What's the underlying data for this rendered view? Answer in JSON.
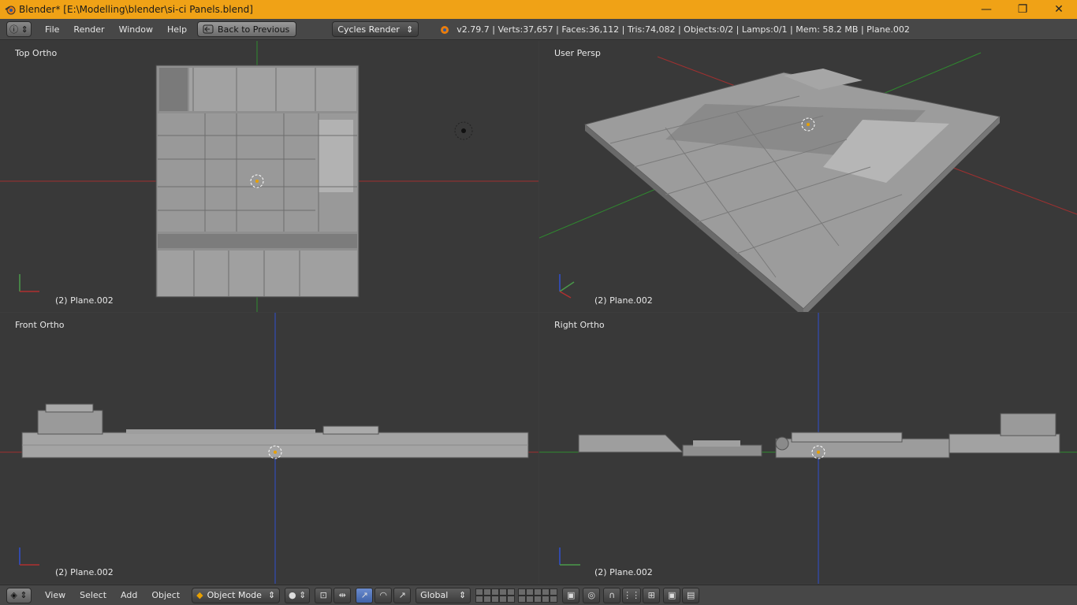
{
  "window": {
    "title": "Blender* [E:\\Modelling\\blender\\si-ci  Panels.blend]",
    "minimize": "—",
    "maximize": "❐",
    "close": "✕"
  },
  "header": {
    "menus": [
      "File",
      "Render",
      "Window",
      "Help"
    ],
    "back_label": "Back to Previous",
    "render_engine": "Cycles Render",
    "stats": "v2.79.7 | Verts:37,657 | Faces:36,112 | Tris:74,082 | Objects:0/2 | Lamps:0/1 | Mem: 58.2 MB | Plane.002"
  },
  "viewports": {
    "top": {
      "label": "Top Ortho",
      "object": "(2) Plane.002"
    },
    "persp": {
      "label": "User Persp",
      "object": "(2) Plane.002"
    },
    "front": {
      "label": "Front Ortho",
      "object": "(2) Plane.002"
    },
    "right": {
      "label": "Right Ortho",
      "object": "(2) Plane.002"
    }
  },
  "footer": {
    "menus": [
      "View",
      "Select",
      "Add",
      "Object"
    ],
    "mode": "Object Mode",
    "orientation": "Global"
  },
  "colors": {
    "titlebar": "#f0a216",
    "viewport_bg": "#393939",
    "header_bg": "#474747",
    "x_axis": "#b03030",
    "y_axis": "#3aa83a",
    "z_axis": "#3050d0",
    "mesh": "#9a9a9a"
  },
  "icons": [
    "blender-logo-icon",
    "info-icon",
    "back-icon",
    "engine-icon",
    "cube-icon",
    "sphere-icon",
    "manipulator-icon",
    "layer-grid-icon",
    "camera-icon"
  ]
}
